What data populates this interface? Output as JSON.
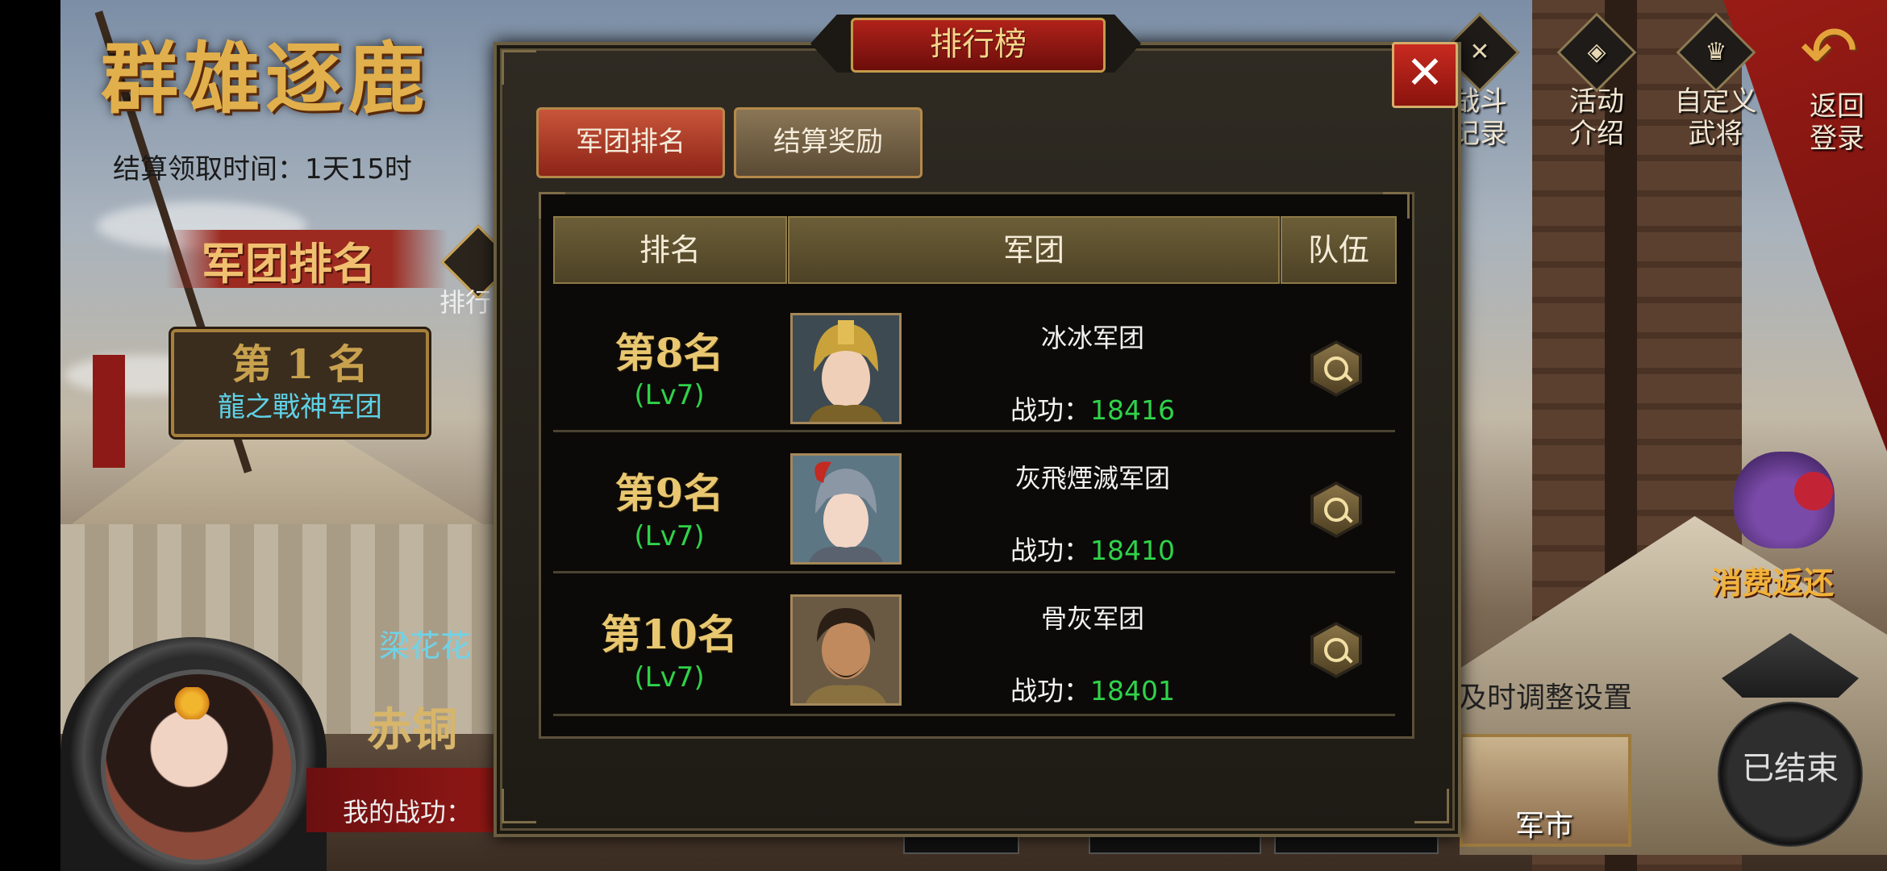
{
  "event": {
    "title": "群雄逐鹿",
    "settle_time": "结算领取时间：1天15时",
    "ranking_banner": "军团排名",
    "side_tab_fragment": "排行",
    "first_place": {
      "rank": "第 1 名",
      "team": "龍之戰神军团"
    },
    "hero_name_fragment": "梁花花",
    "title_fragment": "赤铜",
    "my_merit_label": "我的战功："
  },
  "right_menu": [
    {
      "label_line1": "战斗",
      "label_line2": "记录",
      "icon": "crossed-swords-icon"
    },
    {
      "label_line1": "活动",
      "label_line2": "介绍",
      "icon": "scroll-icon"
    },
    {
      "label_line1": "自定义",
      "label_line2": "武将",
      "icon": "helmet-icon"
    },
    {
      "label_line1": "返回",
      "label_line2": "登录",
      "icon": "back-arrow-icon"
    }
  ],
  "right_panel": {
    "refund_label": "消费返还",
    "adjust_hint": "及时调整设置",
    "market_label": "军市",
    "ended_label": "已结束"
  },
  "modal": {
    "title": "排行榜",
    "close_symbol": "✕",
    "tabs": [
      {
        "label": "军团排名",
        "active": true
      },
      {
        "label": "结算奖励",
        "active": false
      }
    ],
    "columns": {
      "rank": "排名",
      "team": "军团",
      "squad": "队伍"
    },
    "merit_label": "战功：",
    "rows": [
      {
        "rank": "第8名",
        "level": "(Lv7)",
        "team": "冰冰军团",
        "merit": "18416",
        "portrait": "gold-helmet-female-portrait"
      },
      {
        "rank": "第9名",
        "level": "(Lv7)",
        "team": "灰飛煙滅军团",
        "merit": "18410",
        "portrait": "red-plumed-helmet-female-portrait"
      },
      {
        "rank": "第10名",
        "level": "(Lv7)",
        "team": "骨灰军团",
        "merit": "18401",
        "portrait": "bearded-warrior-portrait"
      }
    ]
  },
  "colors": {
    "accent_gold": "#e8c770",
    "merit_green": "#2fd34a",
    "close_red": "#c82a20"
  }
}
